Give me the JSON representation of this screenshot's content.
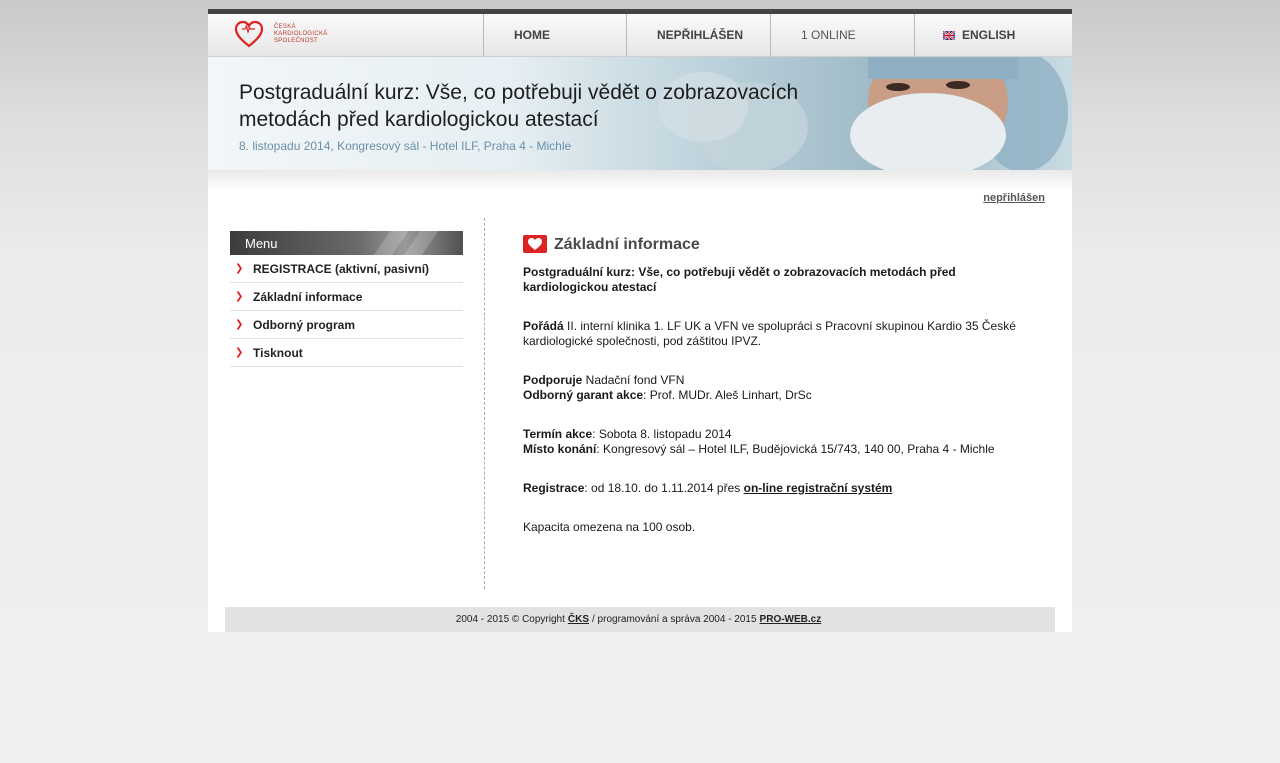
{
  "logo": {
    "lines": [
      "ČESKÁ",
      "KARDIOLOGICKÁ",
      "SPOLEČNOST"
    ]
  },
  "nav": {
    "home": "HOME",
    "login": "NEPŘIHLÁŠEN",
    "online": "1 ONLINE",
    "english": "ENGLISH"
  },
  "banner": {
    "title_line1": "Postgraduální kurz: Vše, co potřebuji vědět o zobrazovacích",
    "title_line2": "metodách před kardiologickou atestací",
    "subtitle": "8. listopadu 2014, Kongresový sál - Hotel ILF, Praha 4 - Michle"
  },
  "user_link": "nepřihlášen",
  "sidebar": {
    "header": "Menu",
    "items": [
      {
        "label": "REGISTRACE (aktivní, pasivní)"
      },
      {
        "label": "Základní informace"
      },
      {
        "label": "Odborný program"
      },
      {
        "label": "Tisknout"
      }
    ]
  },
  "content": {
    "title": "Základní informace",
    "intro": "Postgraduální kurz: Vše, co potřebuji vědět o zobrazovacích metodách před kardiologickou atestací",
    "organizer_label": "Pořádá",
    "organizer_text": " II. interní klinika 1. LF UK a VFN ve spolupráci s Pracovní skupinou Kardio 35 České kardiologické společnosti, pod záštitou IPVZ.",
    "support_label": "Podporuje",
    "support_text": " Nadační fond VFN",
    "guarantor_label": "Odborný garant akce",
    "guarantor_text": ": Prof. MUDr. Aleš Linhart, DrSc",
    "date_label": "Termín akce",
    "date_text": ": Sobota 8. listopadu 2014",
    "place_label": "Místo konání",
    "place_text": ": Kongresový sál – Hotel ILF, Budějovická 15/743, 140 00, Praha 4 - Michle",
    "reg_label": "Registrace",
    "reg_text": ": od 18.10. do 1.11.2014 přes ",
    "reg_link": "on-line registrační systém",
    "capacity": "Kapacita omezena na 100 osob."
  },
  "footer": {
    "pre": "2004 - 2015 © Copyright",
    "link1": "ČKS",
    "mid": "/ programování a správa 2004 - 2015",
    "link2": "PRO-WEB.cz"
  },
  "colors": {
    "accent_red": "#d22222",
    "banner_sub": "#6b8fa8"
  }
}
